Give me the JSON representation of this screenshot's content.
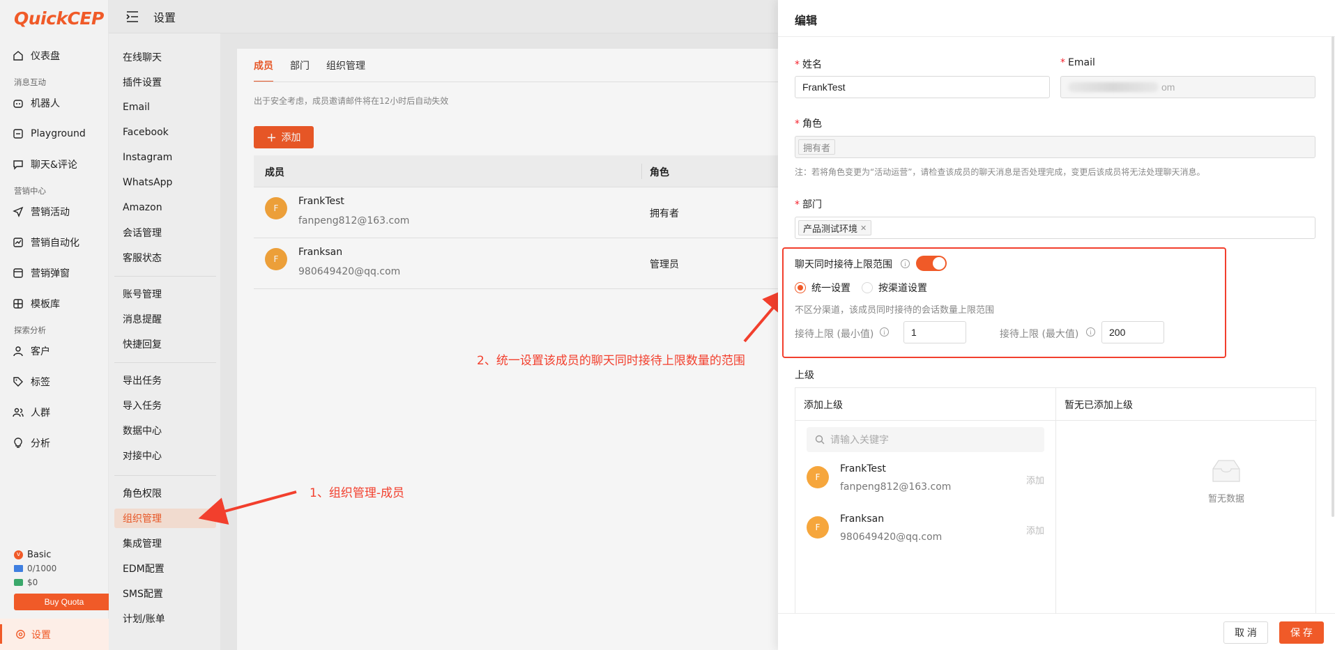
{
  "app": {
    "logo_text": "QuickCEP"
  },
  "nav": {
    "items": [
      {
        "label": "仪表盘",
        "icon": "home-icon"
      },
      {
        "section": "消息互动"
      },
      {
        "label": "机器人",
        "icon": "robot-icon"
      },
      {
        "label": "Playground",
        "icon": "playground-icon"
      },
      {
        "label": "聊天&评论",
        "icon": "chat-icon"
      },
      {
        "section": "营销中心"
      },
      {
        "label": "营销活动",
        "icon": "send-icon"
      },
      {
        "label": "营销自动化",
        "icon": "automation-icon"
      },
      {
        "label": "营销弹窗",
        "icon": "popup-icon"
      },
      {
        "label": "模板库",
        "icon": "template-icon"
      },
      {
        "section": "探索分析"
      },
      {
        "label": "客户",
        "icon": "user-icon"
      },
      {
        "label": "标签",
        "icon": "tag-icon"
      },
      {
        "label": "人群",
        "icon": "group-icon"
      },
      {
        "label": "分析",
        "icon": "bulb-icon"
      }
    ],
    "plan_name": "Basic",
    "plan_badge": "v",
    "quota": "0/1000",
    "balance": "$0",
    "buy_label": "Buy Quota",
    "settings_label": "设置"
  },
  "header": {
    "title": "设置"
  },
  "submenu": {
    "groups": [
      [
        "在线聊天",
        "插件设置",
        "Email",
        "Facebook",
        "Instagram",
        "WhatsApp",
        "Amazon",
        "会话管理",
        "客服状态"
      ],
      [
        "账号管理",
        "消息提醒",
        "快捷回复"
      ],
      [
        "导出任务",
        "导入任务",
        "数据中心",
        "对接中心"
      ],
      [
        "角色权限",
        "组织管理",
        "集成管理",
        "EDM配置",
        "SMS配置",
        "计划/账单"
      ]
    ],
    "active": "组织管理"
  },
  "main": {
    "tabs": [
      {
        "label": "成员",
        "active": true
      },
      {
        "label": "部门"
      },
      {
        "label": "组织管理"
      }
    ],
    "notice": "出于安全考虑，成员邀请邮件将在12小时后自动失效",
    "add_label": "添加",
    "columns": [
      "成员",
      "角色"
    ],
    "rows": [
      {
        "initial": "F",
        "name": "FrankTest",
        "email": "fanpeng812@163.com",
        "role": "拥有者"
      },
      {
        "initial": "F",
        "name": "Franksan",
        "email": "980649420@qq.com",
        "role": "管理员"
      }
    ]
  },
  "annotations": {
    "step1": "1、组织管理-成员",
    "step2": "2、统一设置该成员的聊天同时接待上限数量的范围"
  },
  "drawer": {
    "title": "编辑",
    "name_label": "姓名",
    "name_value": "FrankTest",
    "email_label": "Email",
    "email_value_suffix": "om",
    "role_label": "角色",
    "role_tag": "拥有者",
    "role_note": "注：若将角色变更为“活动运营”，请检查该成员的聊天消息是否处理完成，变更后该成员将无法处理聊天消息。",
    "dept_label": "部门",
    "dept_tag": "产品测试环境",
    "limit_label": "聊天同时接待上限范围",
    "limit_enabled": true,
    "radio_unified": "统一设置",
    "radio_by_channel": "按渠道设置",
    "limit_hint": "不区分渠道，该成员同时接待的会话数量上限范围",
    "min_label": "接待上限 (最小值)",
    "min_value": "1",
    "max_label": "接待上限 (最大值)",
    "max_value": "200",
    "superior_label": "上级",
    "add_superior_header": "添加上级",
    "no_superior_header": "暂无已添加上级",
    "search_placeholder": "请输入关键字",
    "superior_candidates": [
      {
        "initial": "F",
        "name": "FrankTest",
        "email": "fanpeng812@163.com",
        "action": "添加"
      },
      {
        "initial": "F",
        "name": "Franksan",
        "email": "980649420@qq.com",
        "action": "添加"
      }
    ],
    "empty_text": "暂无数据",
    "cancel_label": "取 消",
    "save_label": "保 存"
  },
  "colors": {
    "accent": "#f05a28",
    "annotation": "#f23f2d"
  }
}
